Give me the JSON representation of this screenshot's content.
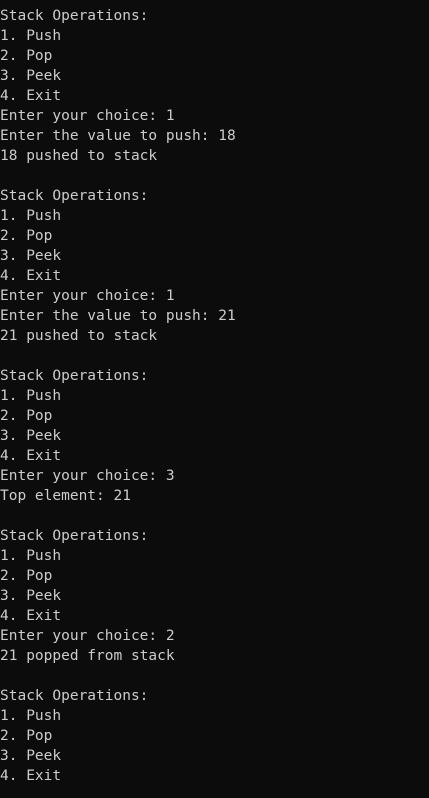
{
  "terminal": {
    "lines": [
      "Stack Operations:",
      "1. Push",
      "2. Pop",
      "3. Peek",
      "4. Exit",
      "Enter your choice: 1",
      "Enter the value to push: 18",
      "18 pushed to stack",
      "",
      "Stack Operations:",
      "1. Push",
      "2. Pop",
      "3. Peek",
      "4. Exit",
      "Enter your choice: 1",
      "Enter the value to push: 21",
      "21 pushed to stack",
      "",
      "Stack Operations:",
      "1. Push",
      "2. Pop",
      "3. Peek",
      "4. Exit",
      "Enter your choice: 3",
      "Top element: 21",
      "",
      "Stack Operations:",
      "1. Push",
      "2. Pop",
      "3. Peek",
      "4. Exit",
      "Enter your choice: 2",
      "21 popped from stack",
      "",
      "Stack Operations:",
      "1. Push",
      "2. Pop",
      "3. Peek",
      "4. Exit"
    ]
  },
  "colors": {
    "background": "#0c0c0c",
    "text": "#cccccc"
  }
}
